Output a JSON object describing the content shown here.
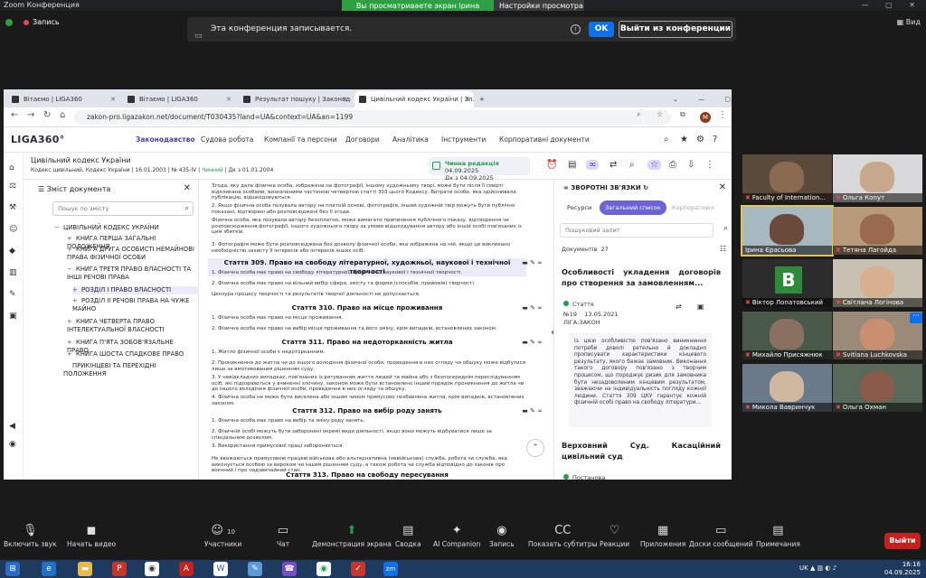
{
  "zoom": {
    "window_title": "Zoom Конференция",
    "share_banner": "Вы просматриваете экран Ірина Єрасьова",
    "view_options": "Настройки просмотра",
    "recording_label": "Запись",
    "view_label": "Вид",
    "recording_message": "Эта конференция записывается.",
    "ok_label": "OK",
    "exit_label": "Выйти из конференции"
  },
  "browser": {
    "tabs": [
      {
        "label": "Вітаємо | LIGA360"
      },
      {
        "label": "Вітаємо | LIGA360"
      },
      {
        "label": "Результат пошуку | Законода..."
      },
      {
        "label": "Цивільний кодекс України | Зл..."
      }
    ],
    "url": "zakon-pro.ligazakon.net/document/T030435?land=UA&context=UA&an=1199"
  },
  "liga": {
    "logo": "LIGA360°",
    "menu": [
      "Законодавство",
      "Судова робота",
      "Компанії та персони",
      "Договори",
      "Аналітика",
      "Інструменти",
      "Корпоративні документи"
    ]
  },
  "document": {
    "title": "Цивільний кодекс України",
    "meta_1": "Кодекс цивільний, Кодекс України",
    "meta_date": "16.01.2003",
    "meta_num": "№ 435-IV",
    "meta_status": "Чинний",
    "meta_effective": "Дк з 01.01.2004",
    "edition_label": "Чинна редакція",
    "edition_date": "04.09.2025",
    "edition_from": "Дк з 04.09.2025"
  },
  "toc": {
    "header": "Зміст документа",
    "search_placeholder": "Пошук по змісту",
    "items": [
      {
        "label": "ЦИВІЛЬНИЙ КОДЕКС УКРАЇНИ",
        "pm": "−"
      },
      {
        "label": "КНИГА ПЕРША ЗАГАЛЬНІ ПОЛОЖЕННЯ",
        "pm": "+"
      },
      {
        "label": "КНИГА ДРУГА ОСОБИСТІ НЕМАЙНОВІ ПРАВА ФІЗИЧНОЇ ОСОБИ",
        "pm": "+"
      },
      {
        "label": "КНИГА ТРЕТЯ ПРАВО ВЛАСНОСТІ ТА ІНШІ РЕЧОВІ ПРАВА",
        "pm": "−"
      },
      {
        "label": "РОЗДІЛ І ПРАВО ВЛАСНОСТІ",
        "pm": "+"
      },
      {
        "label": "РОЗДІЛ ІІ РЕЧОВІ ПРАВА НА ЧУЖЕ МАЙНО",
        "pm": "+"
      },
      {
        "label": "КНИГА ЧЕТВЕРТА ПРАВО ІНТЕЛЕКТУАЛЬНОЇ ВЛАСНОСТІ",
        "pm": "+"
      },
      {
        "label": "КНИГА П'ЯТА ЗОБОВ'ЯЗАЛЬНЕ ПРАВО",
        "pm": "+"
      },
      {
        "label": "КНИГА ШОСТА СПАДКОВЕ ПРАВО",
        "pm": "+"
      },
      {
        "label": "ПРИКІНЦЕВІ ТА ПЕРЕХІДНІ ПОЛОЖЕННЯ",
        "pm": ""
      }
    ]
  },
  "body": {
    "p1": "Згода, яку дала фізична особа, зображена на фотографії, іншому художньому творі, може бути після її смерті відкликана особами, визначеними частиною четвертою статті 303 цього Кодексу. Витрати особи, яка здійснювала публікацію, відшкодовуються.",
    "p2": "2. Якщо фізична особа позувала автору на платній основі, фотографія, інший художній твір можуть бути публічно показані, відтворені або розповсюджені без її згоди.",
    "p3": "Фізична особа, яка позувала автору безоплатно, може вимагати припинення публічного показу, відтворення чи розповсюдження фотографії, іншого художнього твору за умови відшкодування автору або іншій особі пов'язаних із цим збитків.",
    "p4": "3. Фотографія може бути розповсюджена без дозволу фізичної особи, яка зображена на ній, якщо це викликано необхідністю захисту її інтересів або інтересів інших осіб.",
    "a309": "Стаття 309. Право на свободу літературної, художньої, наукової і технічної творчості",
    "p309a": "1. Фізична особа має право на свободу літературної, художньої, наукової і технічної творчості.",
    "p309b": "2. Фізична особа має право на вільний вибір сфери, змісту та форми (способів, прийомів) творчості.",
    "p309c": "Цензура процесу творчості та результатів творчої діяльності не допускається.",
    "a310": "Стаття 310. Право на місце проживання",
    "p310a": "1. Фізична особа має право на місце проживання.",
    "p310b": "2. Фізична особа має право на вибір місця проживання та його зміну, крім випадків, встановлених законом.",
    "a311": "Стаття 311. Право на недоторканність житла",
    "p311a": "1. Житло фізичної особи є недоторканним.",
    "p311b": "2. Проникнення до житла чи до іншого володіння фізичної особи, проведення в них огляду чи обшуку може відбутися лише за вмотивованим рішенням суду.",
    "p311c": "3. У невідкладних випадках, пов'язаних із рятуванням життя людей та майна або з безпосереднім переслідуванням осіб, які підозрюються у вчиненні злочину, законом може бути встановлено інший порядок проникнення до житла чи до іншого володіння фізичної особи, проведення в них огляду та обшуку.",
    "p311d": "4. Фізична особа не може бути виселена або іншим чином примусово позбавлена житла, крім випадків, встановлених законом.",
    "a312": "Стаття 312. Право на вибір роду занять",
    "p312a": "1. Фізична особа має право на вибір та зміну роду занять.",
    "p312b": "2. Фізичній особі можуть бути заборонені окремі види діяльності, якщо вони можуть відбуватися лише за спеціальним дозволом.",
    "p312c": "3. Використання примусової праці забороняється.",
    "p312d": "Не вважаються примусовою працею військова або альтернативна (невійськова) служба, робота чи служба, яка виконується особою за вироком чи іншим рішенням суду, а також робота чи служба відповідно до законів про воєнний і про надзвичайний стан.",
    "a313": "Стаття 313. Право на свободу пересування"
  },
  "right_panel": {
    "header": "ЗВОРОТНІ ЗВ'ЯЗКИ",
    "tabs": [
      "Ресурси",
      "Загальний список",
      "Корпоративні"
    ],
    "search_placeholder": "Пошуковий запит",
    "count_label": "Документів",
    "count": "27",
    "card1_title": "Особливості укладення договорів про створення за замовленням...",
    "card1_type": "Стаття",
    "card1_num": "№19",
    "card1_date": "13.05.2021",
    "card1_source": "ЛІГА:ЗАКОН",
    "card1_text": "Із цією особливістю пов'язано виникнення потреби доволі ретельно й докладно прописувати характеристики кінцевого результату, якого бажає замовник. Виконання такого договору пов'язано з творчим процесом, що породжує ризик для замовника бути незадоволеним кінцевим результатом, зважаючи на індивідуальність погляду кожної людини. Стаття 309 ЦКУ гарантує кожній фізичній особі право на свободу літератури...",
    "card2_title": "Верховний Суд. Касаційний цивільний суд",
    "card2_type": "Постанова"
  },
  "participants": [
    {
      "name": "Faculty of Internation..."
    },
    {
      "name": "Ольга Копут"
    },
    {
      "name": "Ірина Єрасьова"
    },
    {
      "name": "Тетяна Лагойда"
    },
    {
      "name": "Віктор Лопатовський",
      "initial": "B"
    },
    {
      "name": "Світлана Логінова"
    },
    {
      "name": "Михайло Присяжнюк"
    },
    {
      "name": "Svitlana Luchkovska"
    },
    {
      "name": "Микола Вавринчук"
    },
    {
      "name": "Ольга Охман"
    }
  ],
  "toolbar": {
    "audio": "Включить звук",
    "video": "Начать видео",
    "participants": "Участники",
    "participants_count": "10",
    "chat": "Чат",
    "share": "Демонстрация экрана",
    "summary": "Сводка",
    "ai": "AI Companion",
    "record": "Запись",
    "captions": "Показать субтитры",
    "reactions": "Реакции",
    "apps": "Приложения",
    "whiteboards": "Доски сообщений",
    "notes": "Примечания",
    "leave": "Выйти"
  },
  "taskbar": {
    "lang": "UK",
    "time": "16:16",
    "date": "04.09.2025"
  }
}
